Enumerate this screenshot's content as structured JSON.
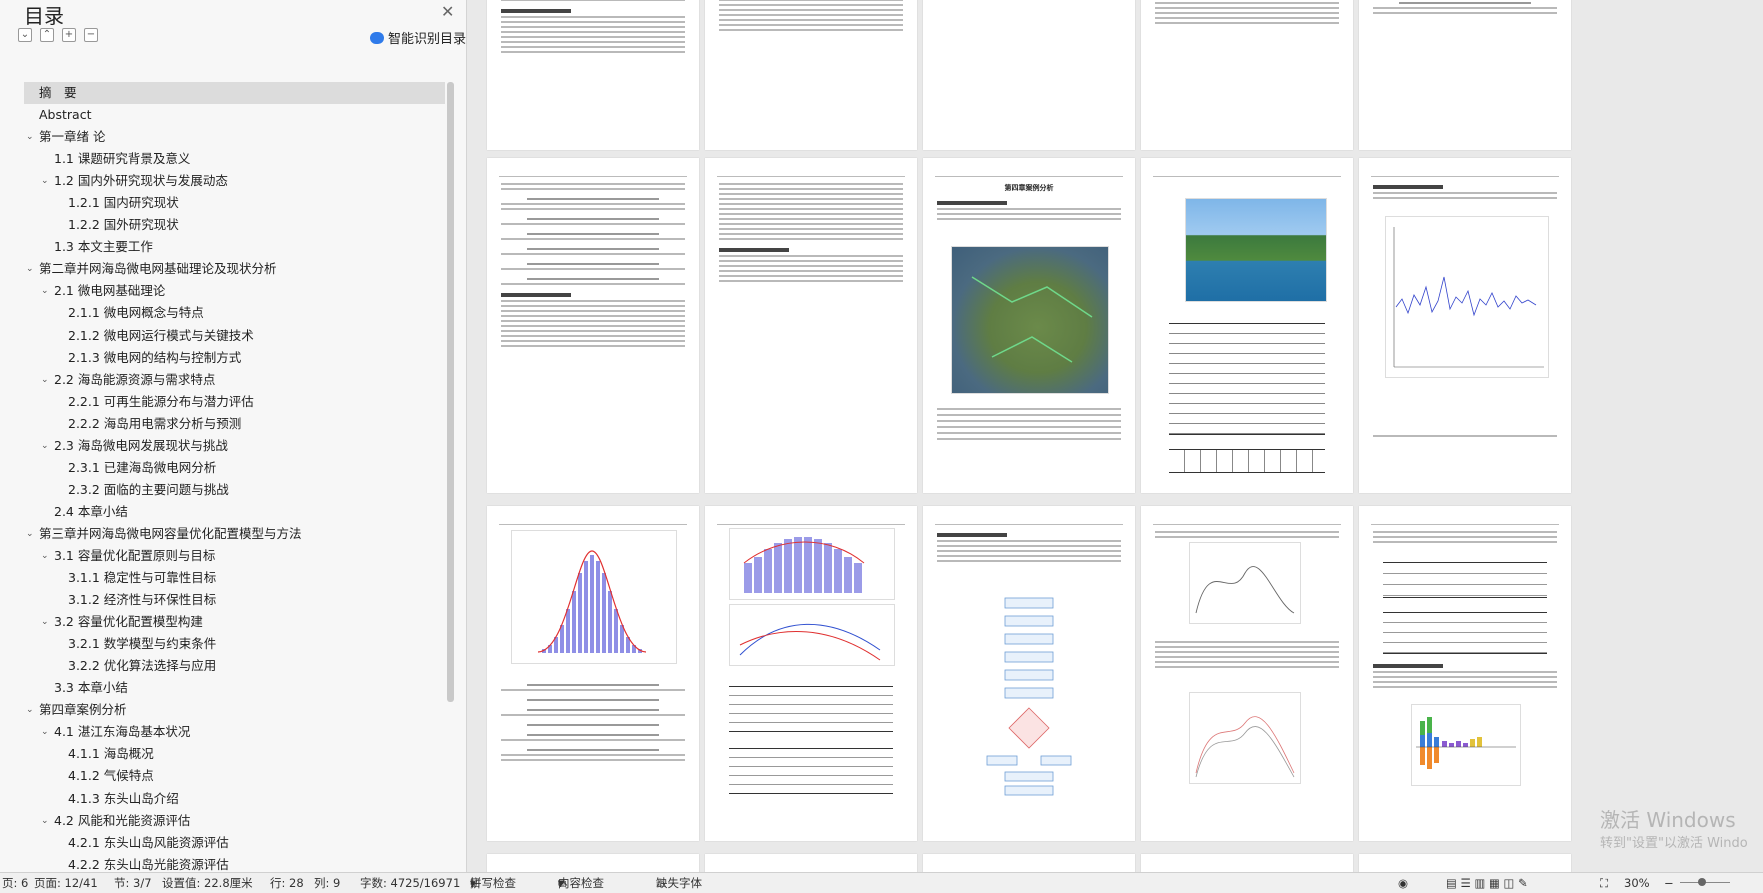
{
  "nav": {
    "title": "目录",
    "smart_label": "智能识别目录",
    "items": [
      {
        "label": "摘　要",
        "level": 0,
        "sel": true,
        "chev": ""
      },
      {
        "label": "Abstract",
        "level": 0,
        "chev": ""
      },
      {
        "label": "第一章绪  论",
        "level": 0,
        "chev": "v"
      },
      {
        "label": "1.1  课题研究背景及意义",
        "level": 1,
        "chev": ""
      },
      {
        "label": "1.2  国内外研究现状与发展动态",
        "level": 1,
        "chev": "v"
      },
      {
        "label": "1.2.1  国内研究现状",
        "level": 2,
        "chev": ""
      },
      {
        "label": "1.2.2  国外研究现状",
        "level": 2,
        "chev": ""
      },
      {
        "label": "1.3 本文主要工作",
        "level": 1,
        "chev": ""
      },
      {
        "label": "第二章并网海岛微电网基础理论及现状分析",
        "level": 0,
        "chev": "v"
      },
      {
        "label": "2.1  微电网基础理论",
        "level": 1,
        "chev": "v"
      },
      {
        "label": "2.1.1  微电网概念与特点",
        "level": 2,
        "chev": ""
      },
      {
        "label": "2.1.2  微电网运行模式与关键技术",
        "level": 2,
        "chev": ""
      },
      {
        "label": "2.1.3  微电网的结构与控制方式",
        "level": 2,
        "chev": ""
      },
      {
        "label": "2.2  海岛能源资源与需求特点",
        "level": 1,
        "chev": "v"
      },
      {
        "label": "2.2.1  可再生能源分布与潜力评估",
        "level": 2,
        "chev": ""
      },
      {
        "label": "2.2.2  海岛用电需求分析与预测",
        "level": 2,
        "chev": ""
      },
      {
        "label": "2.3  海岛微电网发展现状与挑战",
        "level": 1,
        "chev": "v"
      },
      {
        "label": "2.3.1  已建海岛微电网分析",
        "level": 2,
        "chev": ""
      },
      {
        "label": "2.3.2  面临的主要问题与挑战",
        "level": 2,
        "chev": ""
      },
      {
        "label": "2.4  本章小结",
        "level": 1,
        "chev": ""
      },
      {
        "label": "第三章并网海岛微电网容量优化配置模型与方法",
        "level": 0,
        "chev": "v"
      },
      {
        "label": "3.1  容量优化配置原则与目标",
        "level": 1,
        "chev": "v"
      },
      {
        "label": "3.1.1  稳定性与可靠性目标",
        "level": 2,
        "chev": ""
      },
      {
        "label": "3.1.2  经济性与环保性目标",
        "level": 2,
        "chev": ""
      },
      {
        "label": "3.2  容量优化配置模型构建",
        "level": 1,
        "chev": "v"
      },
      {
        "label": "3.2.1  数学模型与约束条件",
        "level": 2,
        "chev": ""
      },
      {
        "label": "3.2.2  优化算法选择与应用",
        "level": 2,
        "chev": ""
      },
      {
        "label": "3.3  本章小结",
        "level": 1,
        "chev": ""
      },
      {
        "label": "第四章案例分析",
        "level": 0,
        "chev": "v"
      },
      {
        "label": "4.1  湛江东海岛基本状况",
        "level": 1,
        "chev": "v"
      },
      {
        "label": "4.1.1  海岛概况",
        "level": 2,
        "chev": ""
      },
      {
        "label": "4.1.2  气候特点",
        "level": 2,
        "chev": ""
      },
      {
        "label": "4.1.3  东头山岛介绍",
        "level": 2,
        "chev": ""
      },
      {
        "label": "4.2  风能和光能资源评估",
        "level": 1,
        "chev": "v"
      },
      {
        "label": "4.2.1  东头山岛风能资源评估",
        "level": 2,
        "chev": ""
      },
      {
        "label": "4.2.2  东头山岛光能资源评估",
        "level": 2,
        "chev": ""
      }
    ]
  },
  "doc": {
    "page_headings": {
      "ch4": "第四章案例分析"
    }
  },
  "status": {
    "page_prefix": "页: 6",
    "page": "页面: 12/41",
    "section": "节: 3/7",
    "setting": "设置值: 22.8厘米",
    "row": "行: 28",
    "col": "列: 9",
    "words": "字数: 4725/16971",
    "spell": "拼写检查",
    "content_check": "内容检查",
    "missing_font": "缺失字体",
    "zoom": "30%"
  },
  "watermark": {
    "line1": "激活 Windows",
    "line2": "转到\"设置\"以激活 Windo"
  }
}
